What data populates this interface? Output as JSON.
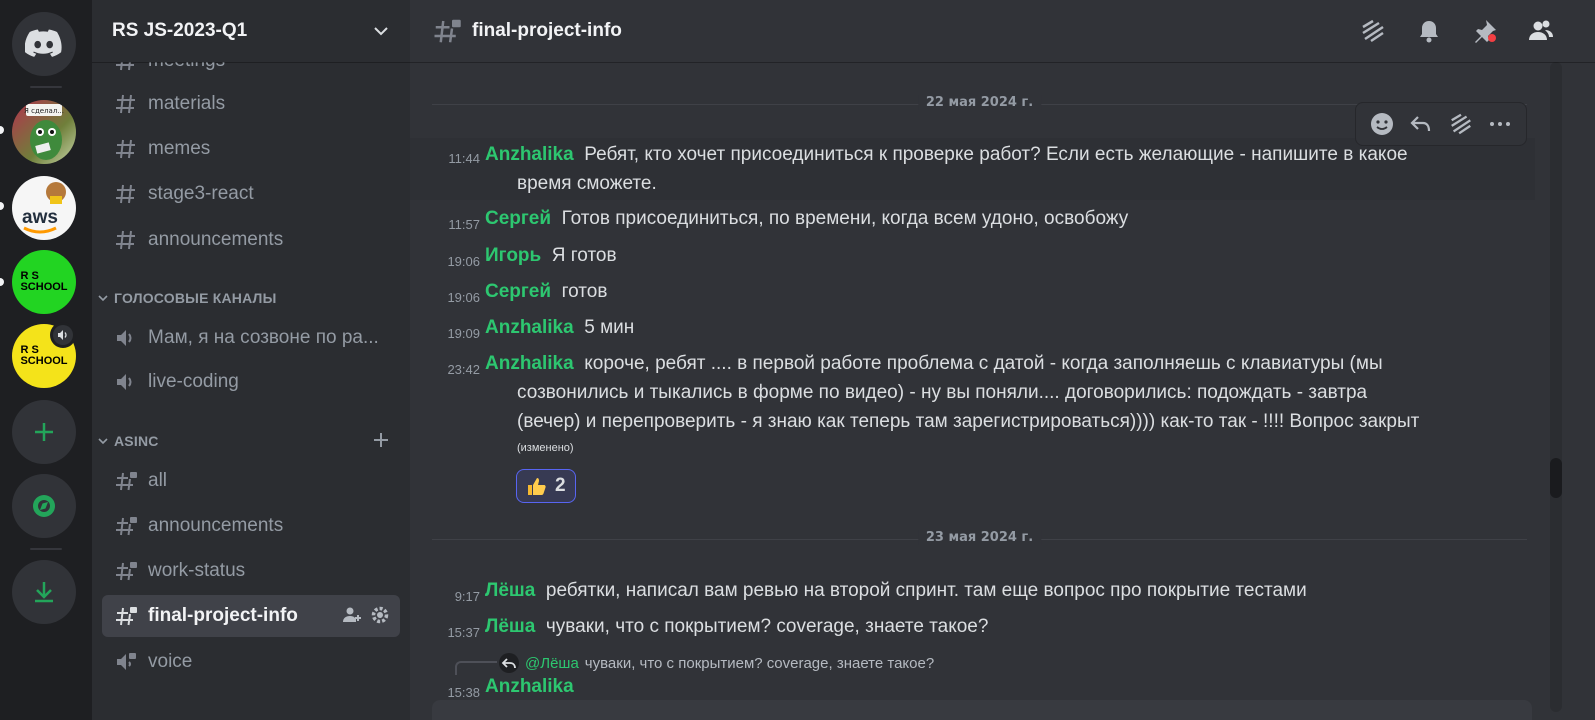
{
  "server_rail": {
    "home_icon": "discord-logo-icon",
    "servers": [
      {
        "name": "server-sticker",
        "caption": "Я сделал..."
      },
      {
        "name": "server-aws",
        "caption": "aws"
      },
      {
        "name": "server-rs-school-green",
        "caption_lines": [
          "R  S",
          "SCHOOL"
        ]
      },
      {
        "name": "server-rs-school-yellow",
        "caption_lines": [
          "R  S",
          "SCHOOL"
        ]
      }
    ],
    "add_server_icon": "plus-icon",
    "explore_icon": "compass-icon",
    "download_icon": "download-icon"
  },
  "sidebar": {
    "guild_name": "RS JS-2023-Q1",
    "channels_top": [
      {
        "label": "meetings",
        "type": "text"
      },
      {
        "label": "materials",
        "type": "text"
      },
      {
        "label": "memes",
        "type": "text"
      },
      {
        "label": "stage3-react",
        "type": "text"
      },
      {
        "label": "announcements",
        "type": "text"
      }
    ],
    "voice_category": "ГОЛОСОВЫЕ КАНАЛЫ",
    "voice_channels": [
      {
        "label": "Мам, я на созвоне по ра..."
      },
      {
        "label": "live-coding"
      }
    ],
    "asinc_category": "ASINC",
    "asinc_channels": [
      {
        "label": "all"
      },
      {
        "label": "announcements"
      },
      {
        "label": "work-status"
      },
      {
        "label": "final-project-info",
        "active": true
      },
      {
        "label": "voice"
      }
    ]
  },
  "header": {
    "channel_name": "final-project-info",
    "icons": [
      "threads-icon",
      "bell-icon",
      "pin-icon",
      "members-icon"
    ]
  },
  "messages": {
    "date_1": "22 мая 2024 г.",
    "date_2": "23 мая 2024 г.",
    "items": [
      {
        "time": "11:44",
        "author": "Anzhalika",
        "text": "Ребят, кто хочет присоединиться к проверке работ? Если есть желающие - напишите в какое",
        "cont": "время сможете."
      },
      {
        "time": "11:57",
        "author": "Сергей",
        "text": "Готов присоединиться, по времени, когда всем удоно, освобожу"
      },
      {
        "time": "19:06",
        "author": "Игорь",
        "text": "Я готов"
      },
      {
        "time": "19:06",
        "author": "Сергей",
        "text": "готов"
      },
      {
        "time": "19:09",
        "author": "Anzhalika",
        "text": "5 мин"
      },
      {
        "time": "23:42",
        "author": "Anzhalika",
        "text": "короче, ребят .... в первой работе проблема с датой - когда заполняешь с клавиатуры (мы",
        "cont_lines": [
          "созвонились и тыкались в форме по видео) - ну вы поняли.... договорились:  подождать - завтра",
          "(вечер) и перепроверить - я знаю как теперь там зарегистрироваться)))) как-то так - !!!! Вопрос закрыт"
        ],
        "edited": "(изменено)"
      },
      {
        "time": "9:17",
        "author": "Лёша",
        "text": "ребятки, написал вам ревью на второй спринт. там еще вопрос про покрытие тестами"
      },
      {
        "time": "15:37",
        "author": "Лёша",
        "text": "чуваки, что с покрытием? coverage, знаете такое?"
      },
      {
        "time": "15:38",
        "author": "Anzhalika",
        "text": ""
      }
    ],
    "reaction": {
      "emoji": "thumbs-up-icon",
      "count": "2"
    },
    "reply": {
      "mention": "@Лёша",
      "text": "чуваки, что с покрытием? coverage, знаете такое?"
    }
  },
  "hover_toolbar": [
    "emoji-icon",
    "reply-icon",
    "thread-icon",
    "more-icon"
  ],
  "colors": {
    "author": "#2dc770",
    "bg": "#313338",
    "sidebar": "#2b2d31",
    "rail": "#1e1f22",
    "accent": "#5865f2"
  }
}
